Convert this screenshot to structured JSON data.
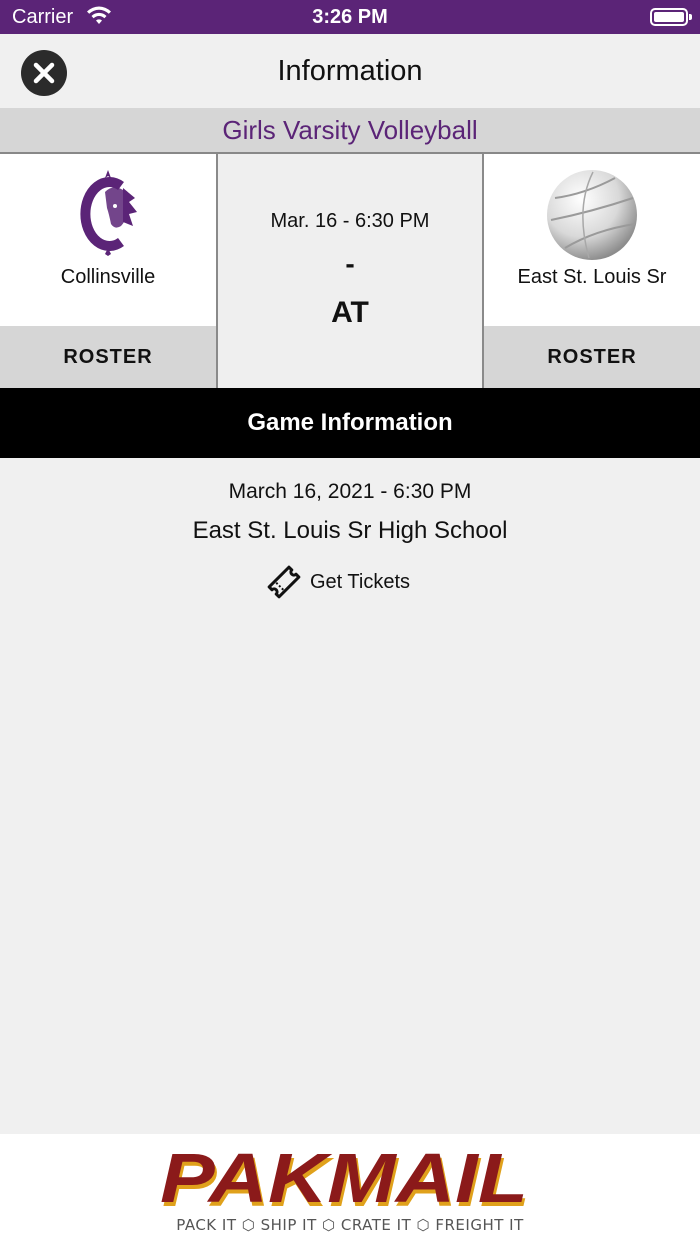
{
  "status_bar": {
    "carrier": "Carrier",
    "time": "3:26 PM"
  },
  "nav": {
    "title": "Information",
    "close_icon": "close-icon"
  },
  "sport": {
    "title": "Girls Varsity Volleyball"
  },
  "teams": {
    "left": {
      "name": "Collinsville",
      "logo": "collinsville-logo",
      "roster_label": "ROSTER"
    },
    "right": {
      "name": "East St. Louis Sr",
      "logo": "volleyball-logo",
      "roster_label": "ROSTER"
    }
  },
  "match": {
    "datetime": "Mar. 16 - 6:30 PM",
    "score": "-",
    "venue_type": "AT"
  },
  "game_info": {
    "header": "Game Information",
    "date": "March 16, 2021 - 6:30 PM",
    "location": "East St. Louis Sr High School",
    "tickets_label": "Get Tickets",
    "tickets_icon": "ticket-icon"
  },
  "ad": {
    "brand": "PAKMAIL",
    "tagline": "PACK IT ⬡ SHIP IT ⬡ CRATE IT ⬡ FREIGHT IT",
    "brand_color": "#8b1a1a",
    "accent_color": "#e0a11b"
  },
  "colors": {
    "purple": "#5b2477",
    "black_bar": "#000000",
    "gray": "#d6d6d6"
  }
}
